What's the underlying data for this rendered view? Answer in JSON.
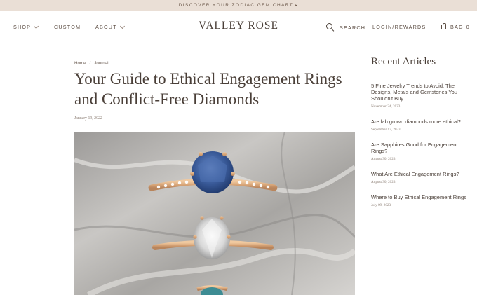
{
  "announcement": {
    "text": "DISCOVER YOUR ZODIAC GEM CHART",
    "arrow": "▸"
  },
  "header": {
    "logo": "VALLEY ROSE",
    "nav_left": [
      "SHOP",
      "CUSTOM",
      "ABOUT"
    ],
    "search_label": "SEARCH",
    "login_label": "LOGIN/REWARDS",
    "bag_label": "BAG",
    "bag_count": "0"
  },
  "breadcrumb": {
    "home": "Home",
    "separator": "/",
    "current": "Journal"
  },
  "article": {
    "title": "Your Guide to Ethical Engagement Rings and Conflict-Free Diamonds",
    "date": "January 19, 2022",
    "hero_image": "three-engagement-rings-on-marble"
  },
  "sidebar": {
    "title": "Recent Articles",
    "items": [
      {
        "title": "5 Fine Jewelry Trends to Avoid: The Designs, Metals and Gemstones You Shouldn't Buy",
        "date": "November 24, 2023"
      },
      {
        "title": "Are lab grown diamonds more ethical?",
        "date": "September 13, 2023"
      },
      {
        "title": "Are Sapphires Good for Engagement Rings?",
        "date": "August 30, 2023"
      },
      {
        "title": "What Are Ethical Engagement Rings?",
        "date": "August 30, 2023"
      },
      {
        "title": "Where to Buy Ethical Engagement Rings",
        "date": "July 09, 2023"
      }
    ]
  },
  "colors": {
    "announcement_bg": "#eadfd6",
    "text": "#4a3f38",
    "gold": "#d9a77a",
    "sapphire": "#3f5f9c"
  }
}
